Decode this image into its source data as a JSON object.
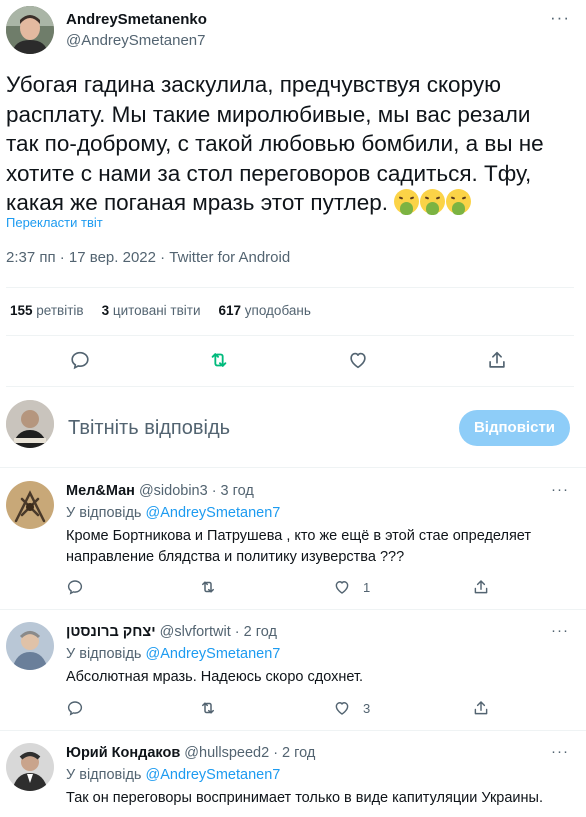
{
  "tweet": {
    "author_name": "AndreySmetanenko",
    "author_handle": "@AndreySmetanen7",
    "text": "Убогая гадина заскулила, предчувствуя скорую расплату. Мы такие миролюбивые, мы вас резали так по-доброму, с такой любовью бомбили, а вы не хотите с нами за стол переговоров садиться. Тфу, какая же поганая мразь этот путлер.",
    "emoji": [
      "vomit-face-emoji",
      "vomit-face-emoji",
      "vomit-face-emoji"
    ],
    "translate_label": "Перекласти твіт",
    "timestamp": "2:37 пп · 17 вер. 2022 · Twitter for Android",
    "more": "···"
  },
  "stats": {
    "retweets_count": "155",
    "retweets_label": "ретвітів",
    "quotes_count": "3",
    "quotes_label": "цитовані твіти",
    "likes_count": "617",
    "likes_label": "уподобань"
  },
  "actions": {
    "icons": [
      "reply-icon",
      "retweet-icon",
      "like-icon",
      "share-icon"
    ],
    "retweet_color": "#00ba7c"
  },
  "reply_box": {
    "placeholder": "Твітніть відповідь",
    "button_label": "Відповісти",
    "button_color": "#8ecdf8"
  },
  "replies": [
    {
      "name": "Мел&Ман",
      "handle": "@sidobin3",
      "time": "· 3 год",
      "reply_to_prefix": "У відповідь",
      "reply_to_handle": "@AndreySmetanen7",
      "text": "Кроме Бортникова и Патрушева , кто же ещё в этой стае определяет направление блядства и политику изуверства ???",
      "likes": "1"
    },
    {
      "name": "יצחק ברונסטן",
      "handle": "@slvfortwit",
      "time": "· 2 год",
      "reply_to_prefix": "У відповідь",
      "reply_to_handle": "@AndreySmetanen7",
      "text": "Абсолютная мразь. Надеюсь скоро сдохнет.",
      "likes": "3"
    },
    {
      "name": "Юрий Кондаков",
      "handle": "@hullspeed2",
      "time": "· 2 год",
      "reply_to_prefix": "У відповідь",
      "reply_to_handle": "@AndreySmetanen7",
      "text": "Так он переговоры воспринимает только в виде капитуляции Украины."
    }
  ],
  "reply_more": "···"
}
